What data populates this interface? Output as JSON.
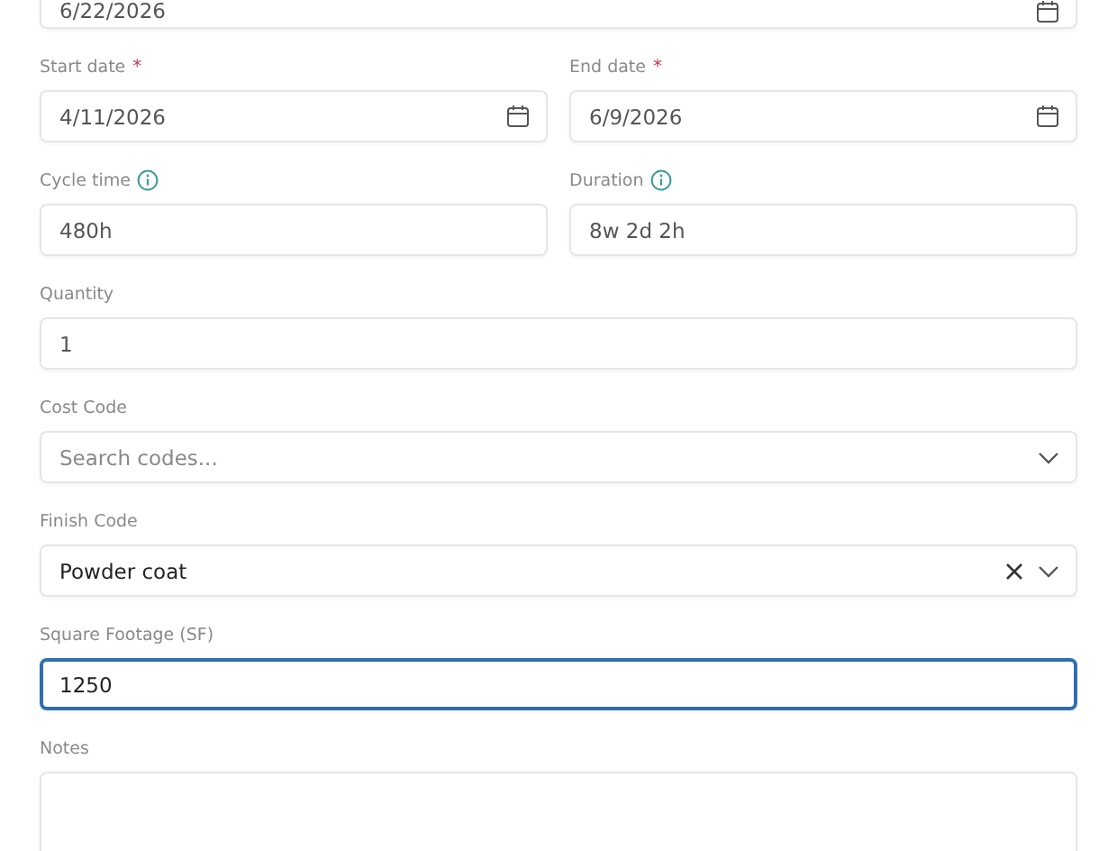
{
  "rows": [
    [
      {
        "kind": "date",
        "info": false,
        "value": "6/22/2026",
        "focused": false,
        "clearable": false
      }
    ],
    [
      {
        "kind": "date",
        "label": "Start date",
        "required_mark": "*",
        "info": false,
        "value": "4/11/2026",
        "focused": false,
        "clearable": false
      },
      {
        "kind": "date",
        "label": "End date",
        "required_mark": "*",
        "info": false,
        "value": "6/9/2026",
        "focused": false,
        "clearable": false
      }
    ],
    [
      {
        "kind": "text",
        "label": "Cycle time",
        "info": true,
        "value": "480h",
        "focused": false,
        "clearable": false
      },
      {
        "kind": "text",
        "label": "Duration",
        "info": true,
        "value": "8w 2d 2h",
        "focused": false,
        "clearable": false
      }
    ],
    [
      {
        "kind": "text",
        "label": "Quantity",
        "info": false,
        "value": "1",
        "focused": false,
        "clearable": false
      }
    ],
    [
      {
        "kind": "select",
        "label": "Cost Code",
        "info": false,
        "placeholder": "Search codes...",
        "focused": false,
        "clearable": false
      }
    ],
    [
      {
        "kind": "select",
        "label": "Finish Code",
        "info": false,
        "value": "Powder coat",
        "focused": false,
        "clearable": true
      }
    ],
    [
      {
        "kind": "text",
        "label": "Square Footage (SF)",
        "info": false,
        "value": "1250",
        "focused": true,
        "clearable": false
      }
    ],
    [
      {
        "kind": "textarea",
        "label": "Notes",
        "info": false,
        "focused": false,
        "clearable": false
      }
    ]
  ]
}
